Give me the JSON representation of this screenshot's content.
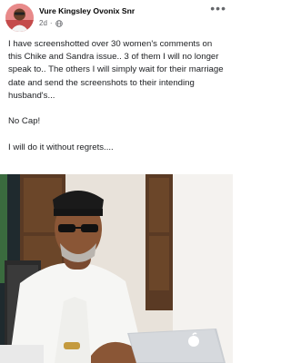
{
  "post": {
    "author_name": "Vure Kingsley Ovonix Snr",
    "time_ago": "2d",
    "audience_icon": "globe-icon",
    "menu_icon": "more-options-icon",
    "paragraphs": [
      "I have screenshotted over 30 women's comments on this Chike and Sandra issue.. 3 of them I will no longer speak to.. The others I will simply wait for their marriage date and send the screenshots to their intending husband's...",
      "No Cap!",
      "I will do it without regrets...."
    ]
  },
  "colors": {
    "secondary_text": "#65676b",
    "primary_text": "#1c1e21"
  }
}
